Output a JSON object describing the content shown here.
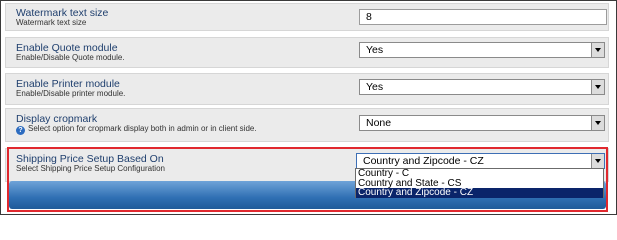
{
  "settings": [
    {
      "title": "Watermark text size",
      "description": "Watermark text size",
      "value": "8"
    },
    {
      "title": "Enable Quote module",
      "description": "Enable/Disable Quote module.",
      "value": "Yes"
    },
    {
      "title": "Enable Printer module",
      "description": "Enable/Disable printer module.",
      "value": "Yes"
    },
    {
      "title": "Display cropmark",
      "description": "Select option for cropmark display both in admin or in client side.",
      "value": "None"
    },
    {
      "title": "Shipping Price Setup Based On",
      "description": "Select Shipping Price Setup Configuration",
      "value": "Country and Zipcode - CZ"
    }
  ],
  "shipping_dropdown": {
    "options": [
      "Country - C",
      "Country and State - CS",
      "Country and Zipcode - CZ"
    ],
    "selected": "Country and Zipcode - CZ"
  },
  "icons": {
    "help": "help-icon"
  },
  "colors": {
    "highlight": "#e0282e",
    "selected_option": "#0a246a",
    "title_text": "#1f3f6e"
  }
}
